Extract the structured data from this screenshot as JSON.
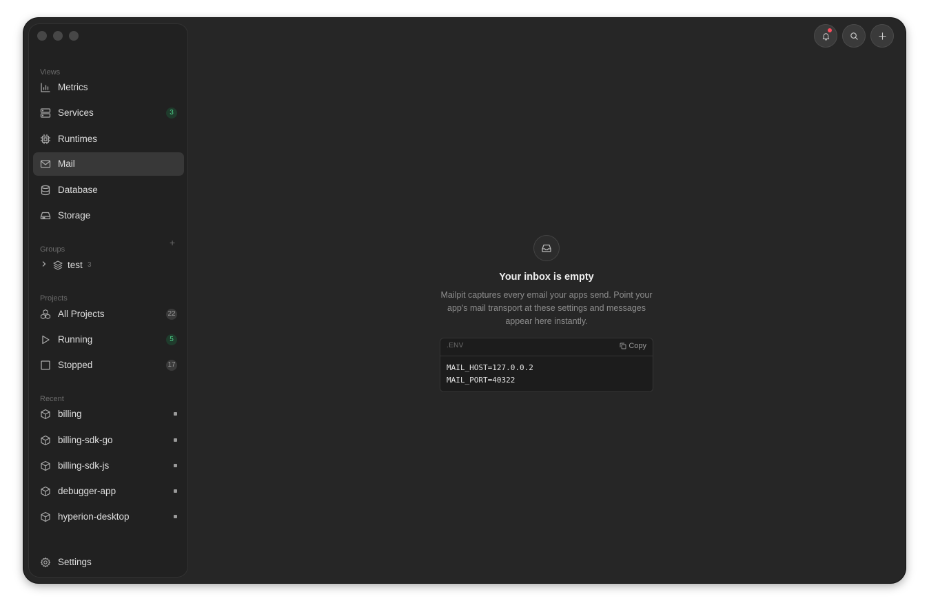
{
  "sidebar": {
    "sections": {
      "views": "Views",
      "groups": "Groups",
      "projects": "Projects",
      "recent": "Recent"
    },
    "views": [
      {
        "label": "Metrics",
        "icon": "bar-chart-icon"
      },
      {
        "label": "Services",
        "icon": "server-icon",
        "badge": "3"
      },
      {
        "label": "Runtimes",
        "icon": "cpu-icon"
      },
      {
        "label": "Mail",
        "icon": "mail-icon",
        "active": true
      },
      {
        "label": "Database",
        "icon": "database-icon"
      },
      {
        "label": "Storage",
        "icon": "hard-drive-icon"
      }
    ],
    "group": {
      "label": "test",
      "count": "3",
      "add": "+"
    },
    "projects": [
      {
        "label": "All Projects",
        "badge": "22"
      },
      {
        "label": "Running",
        "badge": "5"
      },
      {
        "label": "Stopped",
        "badge": "17"
      }
    ],
    "recent": [
      {
        "label": "billing"
      },
      {
        "label": "billing-sdk-go"
      },
      {
        "label": "billing-sdk-js"
      },
      {
        "label": "debugger-app"
      },
      {
        "label": "hyperion-desktop"
      }
    ],
    "settings": "Settings"
  },
  "toolbar": {
    "buttons": [
      "bell-icon",
      "search-icon",
      "plus-icon"
    ]
  },
  "empty_state": {
    "title": "Your inbox is empty",
    "description": "Mailpit captures every email your apps send. Point your app's mail transport at these settings and messages appear here instantly.",
    "env_label": ".ENV",
    "copy_label": "Copy",
    "lines": [
      "MAIL_HOST=127.0.0.2",
      "MAIL_PORT=40322"
    ]
  },
  "colors": {
    "accent_green": "#4fd08a",
    "notification": "#ff4d5e",
    "background": "#262626",
    "sidebar": "#212121"
  }
}
